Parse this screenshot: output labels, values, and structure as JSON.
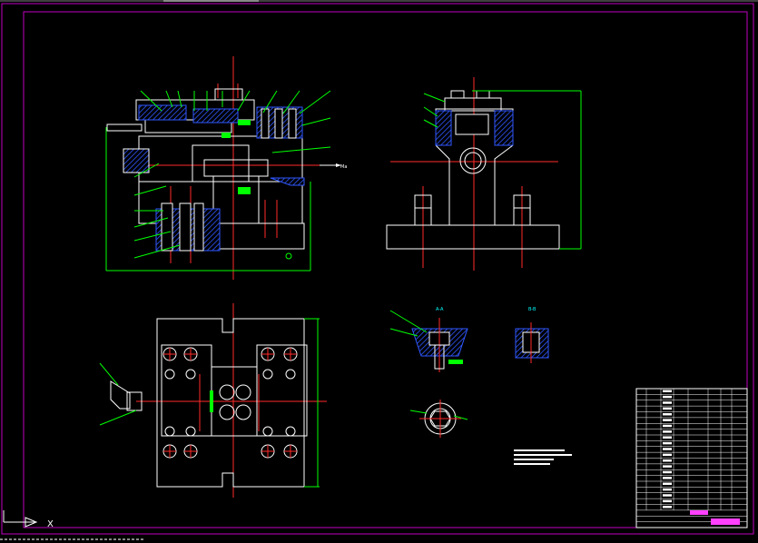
{
  "colors": {
    "background": "#000000",
    "outline": "#ffffff",
    "centerline": "#ff2a2a",
    "dimension": "#00ff00",
    "section_hatch": "#2f57ff",
    "frame": "#c000c0",
    "label": "#00ffff"
  },
  "views": {
    "front_view": {
      "name": "front-view"
    },
    "side_view": {
      "name": "side-view"
    },
    "top_view": {
      "name": "top-view"
    },
    "section_a": {
      "title": "A-A"
    },
    "section_b": {
      "title": "B-B"
    },
    "detail_view": {
      "title": ""
    }
  },
  "front_view_arrow_label": "Ma",
  "ucs_icon": {
    "name": "ucs-icon",
    "axis_label": "X"
  }
}
